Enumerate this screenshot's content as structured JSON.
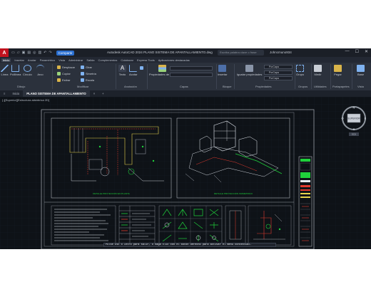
{
  "titlebar": {
    "app_letter": "A",
    "share_label": "Compartir",
    "window_title": "Autodesk AutoCAD 2024  PLANO SISTEMA DE APANTALLAMIENTO.dwg",
    "search_placeholder": "Escriba palabra clave o frase",
    "user": "Johncmuno934",
    "win_min": "—",
    "win_max": "☐",
    "win_close": "✕"
  },
  "menubar": {
    "items": [
      "Inicio",
      "Insertar",
      "Anotar",
      "Paramétrico",
      "Vista",
      "Administrar",
      "Salida",
      "Complementos",
      "Colaborar",
      "Express Tools",
      "Aplicaciones destacadas"
    ]
  },
  "ribbon": {
    "draw": {
      "linea": "Línea",
      "polilinea": "Polilínea",
      "circulo": "Círculo",
      "arco": "Arco",
      "panel": "Dibujo"
    },
    "modify": {
      "desplazar": "Desplazar",
      "girar": "Girar",
      "copiar": "Copiar",
      "simetria": "Simetría",
      "estirar": "Estirar",
      "escala": "Escala",
      "panel": "Modificar"
    },
    "annotation": {
      "texto": "Texto",
      "acotar": "Acotar",
      "panel": "Anotación"
    },
    "layers": {
      "propiedades": "Propiedades de capa",
      "panel": "Capas"
    },
    "block": {
      "insertar": "Insertar",
      "panel": "Bloque"
    },
    "properties": {
      "igualar": "Igualar propiedades",
      "porcapa1": "PorCapa",
      "porcapa2": "PorCapa",
      "porcapa3": "PorCapa",
      "panel": "Propiedades"
    },
    "groups": {
      "grupo": "Grupo",
      "panel": "Grupos"
    },
    "utilities": {
      "medir": "Medir",
      "panel": "Utilidades"
    },
    "clipboard": {
      "pegar": "Pegar",
      "panel": "Portapapeles"
    },
    "view": {
      "base": "Base",
      "panel": "Vista"
    }
  },
  "tabs": {
    "home": "Inicio",
    "file": "PLANO SISTEMA DE APANTALLAMIENTO"
  },
  "viewport_label": "[-][Superior][Estructura alámbrica 2D]",
  "drawing": {
    "left_caption": "DETALLE PROYECCION EN PLANTA",
    "right_caption": "DETALLE PROYECCION ISOMETRICO",
    "accent_green": "#1fd13b",
    "accent_red": "#e23a2f",
    "accent_yellow": "#e8d44d",
    "frame_color": "#9aa0a8"
  },
  "viewcube": {
    "label": "SUPERIOR",
    "n": "N",
    "s": "S",
    "e": "E",
    "o": "O",
    "wcs": "SCU"
  },
  "command_line": "Pulse Esc o Intro para salir, o haga clic con el botón derecho para activar el menú contextual."
}
